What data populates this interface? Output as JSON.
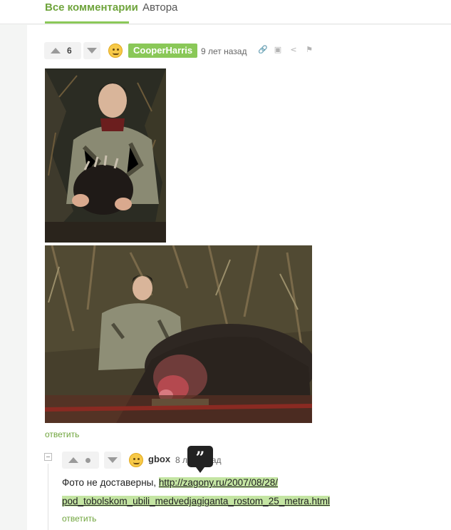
{
  "tabs": {
    "all": "Все комментарии",
    "authors": "Автора"
  },
  "comment1": {
    "score": "6",
    "author": "CooperHarris",
    "time": "9 лет назад",
    "tools": [
      "link-icon",
      "save-icon",
      "share-icon",
      "flag-icon"
    ],
    "reply": "ответить"
  },
  "comment2": {
    "author": "gbox",
    "time": "8 лет назад",
    "text_prefix": "Фото не доставерны, ",
    "link_line1": "http://zagony.ru/2007/08/28/",
    "link_line2": "pod_tobolskom_ubili_medvedjagiganta_rostom_25_metra.html",
    "reply": "ответить"
  },
  "tooltip_icon": "quote-icon",
  "colors": {
    "accent": "#8ac858",
    "link_highlight": "#c4e5a3",
    "tab_active": "#6fa43c"
  }
}
